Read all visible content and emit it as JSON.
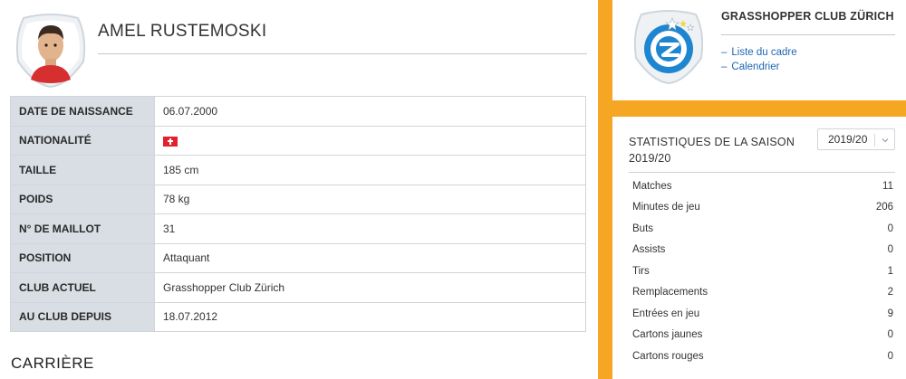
{
  "player": {
    "name": "AMEL RUSTEMOSKI"
  },
  "info": [
    {
      "label": "DATE DE NAISSANCE",
      "value": "06.07.2000"
    },
    {
      "label": "NATIONALITÉ",
      "value": "",
      "flag": "switzerland-flag-icon"
    },
    {
      "label": "TAILLE",
      "value": "185 cm"
    },
    {
      "label": "POIDS",
      "value": "78 kg"
    },
    {
      "label": "N° DE MAILLOT",
      "value": "31"
    },
    {
      "label": "POSITION",
      "value": "Attaquant"
    },
    {
      "label": "CLUB ACTUEL",
      "value": "Grasshopper Club Zürich"
    },
    {
      "label": "AU CLUB DEPUIS",
      "value": "18.07.2012"
    }
  ],
  "career_heading": "CARRIÈRE",
  "club": {
    "title": "GRASSHOPPER CLUB ZÜRICH",
    "links": [
      {
        "dash": "–",
        "label": "Liste du cadre"
      },
      {
        "dash": "–",
        "label": "Calendrier"
      }
    ]
  },
  "stats": {
    "title": "STATISTIQUES DE LA SAISON 2019/20",
    "season_selected": "2019/20",
    "rows": [
      {
        "label": "Matches",
        "value": "11"
      },
      {
        "label": "Minutes de jeu",
        "value": "206"
      },
      {
        "label": "Buts",
        "value": "0"
      },
      {
        "label": "Assists",
        "value": "0"
      },
      {
        "label": "Tirs",
        "value": "1"
      },
      {
        "label": "Remplacements",
        "value": "2"
      },
      {
        "label": "Entrées en jeu",
        "value": "9"
      },
      {
        "label": "Cartons jaunes",
        "value": "0"
      },
      {
        "label": "Cartons rouges",
        "value": "0"
      }
    ]
  },
  "colors": {
    "accent_orange": "#f5a623",
    "link_blue": "#1f66b3",
    "table_label_bg": "#d8dee4",
    "club_blue": "#1e86d0"
  }
}
